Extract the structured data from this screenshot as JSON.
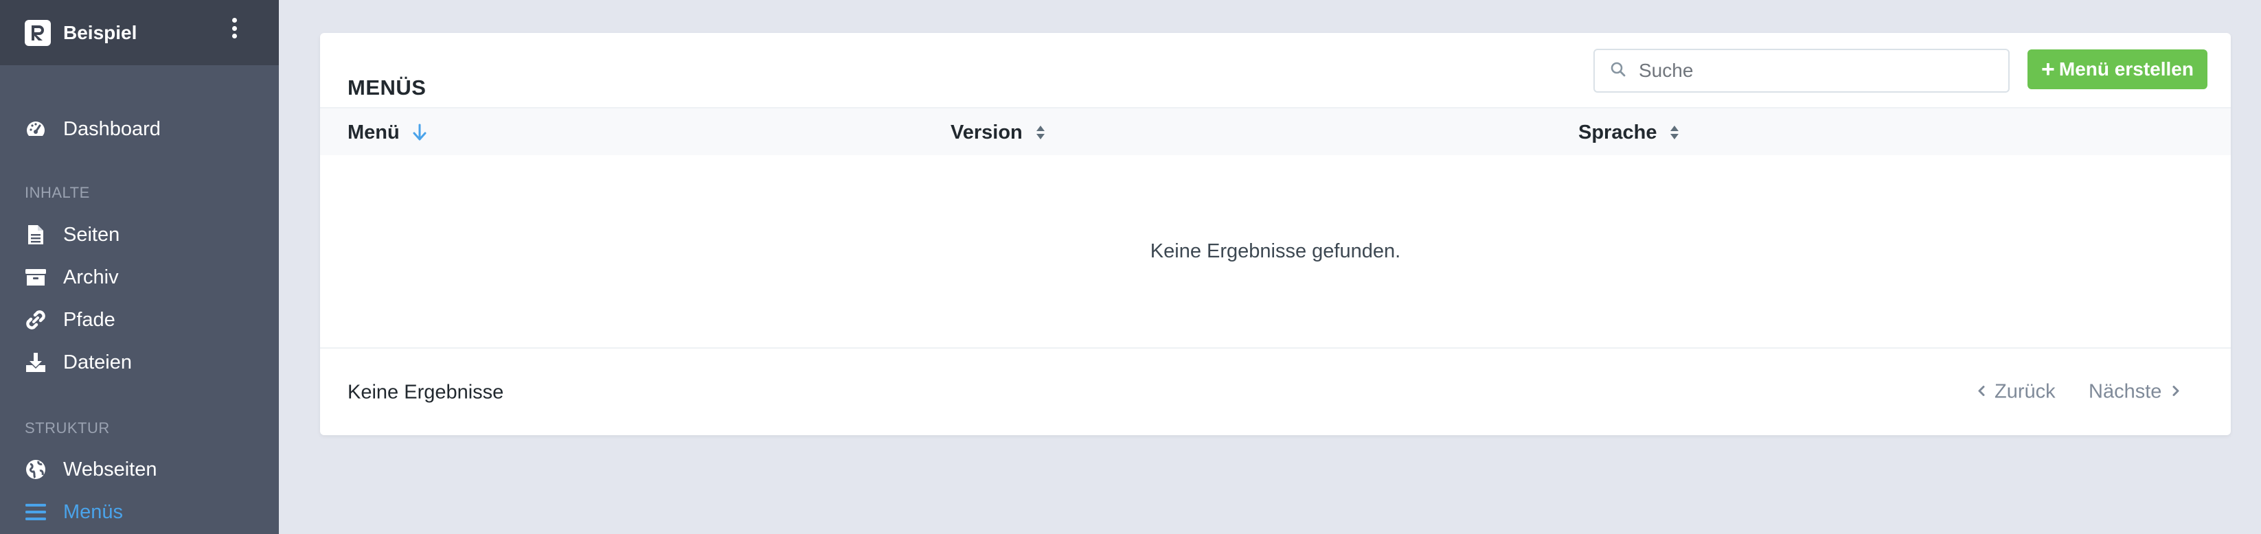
{
  "sidebar": {
    "app_name": "Beispiel",
    "logo_letter": "R",
    "sections": {
      "content_label": "INHALTE",
      "structure_label": "STRUKTUR"
    },
    "items": {
      "dashboard": "Dashboard",
      "seiten": "Seiten",
      "archiv": "Archiv",
      "pfade": "Pfade",
      "dateien": "Dateien",
      "webseiten": "Webseiten",
      "menus": "Menüs"
    }
  },
  "main": {
    "title": "MENÜS",
    "search": {
      "placeholder": "Suche",
      "value": ""
    },
    "create_button": {
      "plus": "+",
      "label": "Menü erstellen"
    },
    "columns": {
      "menu": "Menü",
      "version": "Version",
      "sprache": "Sprache"
    },
    "empty_message": "Keine Ergebnisse gefunden.",
    "footer": {
      "count_text": "Keine Ergebnisse",
      "prev": "Zurück",
      "next": "Nächste"
    }
  },
  "colors": {
    "sidebar_bg": "#4e5667",
    "sidebar_header_bg": "#3d4350",
    "active_blue": "#4aa3ea",
    "create_green": "#6bc34f",
    "page_bg": "#e3e6ee"
  },
  "icons": {
    "dashboard": "tachometer-icon",
    "seiten": "file-icon",
    "archiv": "archive-box-icon",
    "pfade": "link-icon",
    "dateien": "download-icon",
    "webseiten": "globe-icon",
    "menus": "bars-icon"
  }
}
